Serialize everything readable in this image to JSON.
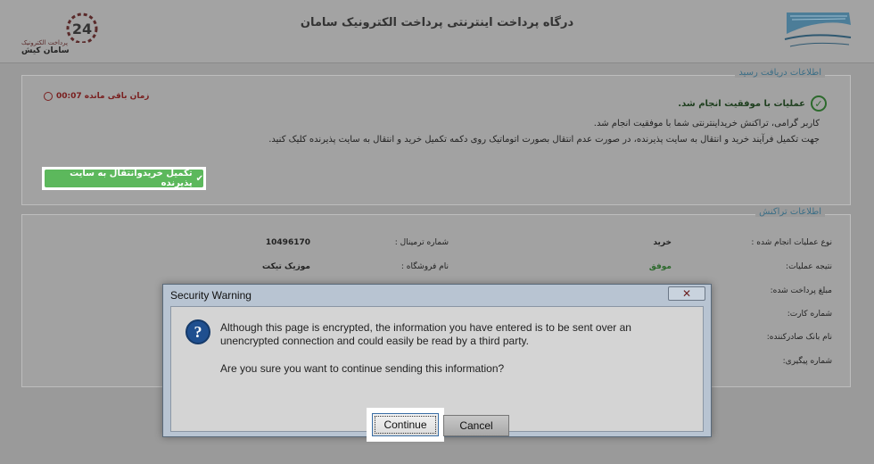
{
  "header": {
    "title": "درگاه پرداخت اینترنتی پرداخت الکترونیک سامان",
    "left_logo_line1": "پرداخت الکترونیک",
    "left_logo_line2": "سامان کیش",
    "left_logo_number": "24"
  },
  "receipt": {
    "legend": "اطلاعات دریافت رسید",
    "timer": "زمان باقی مانده 00:07",
    "success": "عملیات با موفقیت انجام شد.",
    "message1": "کاربر گرامی، تراکنش خریداینترنتی شما با موفقیت انجام شد.",
    "message2": "جهت تکمیل فرآیند خرید و انتقال به سایت پذیرنده، در صورت عدم انتقال بصورت اتوماتیک روی دکمه تکمیل خرید و انتقال به سایت پذیرنده کلیک کنید.",
    "complete_button": "تکمیل خریدوانتقال به سایت پذیرنده"
  },
  "transaction": {
    "legend": "اطلاعات تراکنش",
    "fields": [
      {
        "label": "نوع عملیات انجام شده :",
        "value": "خرید"
      },
      {
        "label": "نتیجه عملیات:",
        "value": "موفق"
      },
      {
        "label": "مبلغ پرداخت شده:",
        "value": ""
      },
      {
        "label": "شماره کارت:",
        "value": ""
      },
      {
        "label": "نام بانک صادرکننده:",
        "value": ""
      },
      {
        "label": "شماره پیگیری:",
        "value": ""
      }
    ],
    "terminal_label": "شماره ترمینال :",
    "terminal_value": "10496170",
    "merchant_label": "نام فروشگاه :",
    "merchant_value": "موزیک تیکت"
  },
  "dialog": {
    "title": "Security Warning",
    "close_glyph": "✕",
    "message": "Although this page is encrypted, the information you have entered is to be sent over an unencrypted connection and could easily be read by a third party.",
    "question": "Are you sure you want to continue sending this information?",
    "continue_label": "Continue",
    "cancel_label": "Cancel"
  }
}
